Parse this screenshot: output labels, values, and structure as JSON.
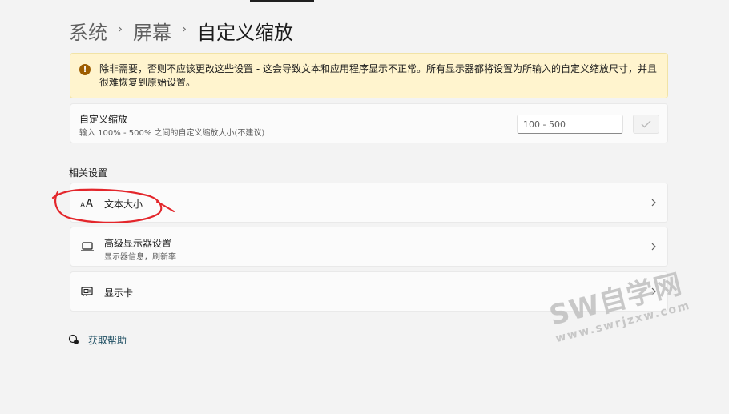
{
  "breadcrumb": {
    "items": [
      "系统",
      "屏幕"
    ],
    "current": "自定义缩放",
    "separator": "›"
  },
  "warning": {
    "icon": "warning-icon",
    "text": "除非需要，否则不应该更改这些设置 - 这会导致文本和应用程序显示不正常。所有显示器都将设置为所输入的自定义缩放尺寸，并且很难恢复到原始设置。"
  },
  "custom_scaling": {
    "title": "自定义缩放",
    "subtitle": "输入 100% - 500% 之间的自定义缩放大小(不建议)",
    "placeholder": "100 - 500",
    "value": "",
    "confirm_icon": "check-icon"
  },
  "related": {
    "label": "相关设置",
    "items": [
      {
        "title": "文本大小",
        "subtitle": "",
        "icon": "text-size-icon"
      },
      {
        "title": "高级显示器设置",
        "subtitle": "显示器信息，刷新率",
        "icon": "monitor-icon"
      },
      {
        "title": "显示卡",
        "subtitle": "",
        "icon": "graphics-card-icon"
      }
    ]
  },
  "help": {
    "label": "获取帮助",
    "icon": "help-icon"
  },
  "watermark": {
    "main": "SW自学网",
    "url": "www.swrjzxw.com"
  },
  "colors": {
    "background": "#f3f3f3",
    "card": "#fbfbfb",
    "warning_bg": "#fff4ce",
    "warning_icon": "#9d5d00",
    "annotation": "#e3262b",
    "link": "#1f4f63"
  }
}
